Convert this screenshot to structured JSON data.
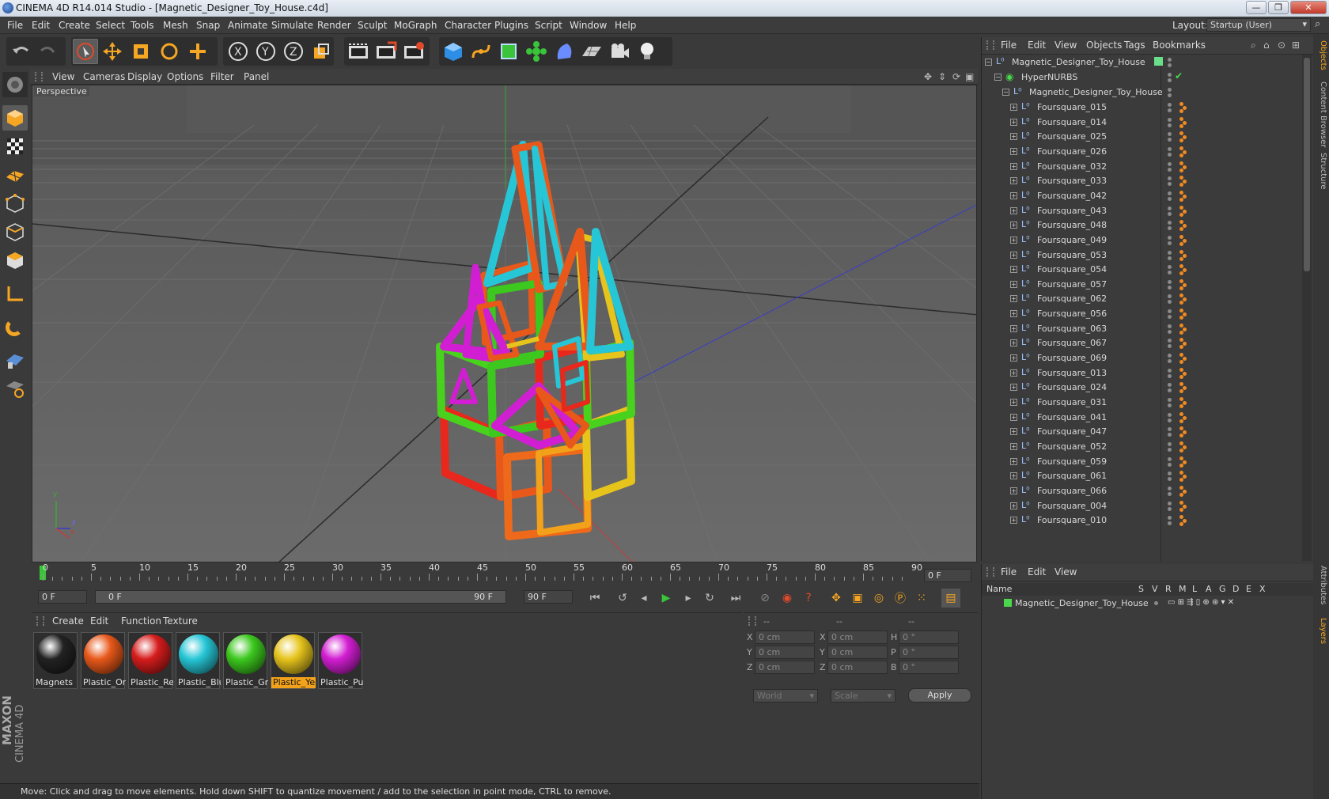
{
  "window": {
    "title": "CINEMA 4D R14.014 Studio - [Magnetic_Designer_Toy_House.c4d]",
    "min": "—",
    "max": "❐",
    "close": "✕"
  },
  "menu": [
    "File",
    "Edit",
    "Create",
    "Select",
    "Tools",
    "Mesh",
    "Snap",
    "Animate",
    "Simulate",
    "Render",
    "Sculpt",
    "MoGraph",
    "Character",
    "Plugins",
    "Script",
    "Window",
    "Help"
  ],
  "layout": {
    "label": "Layout:",
    "value": "Startup (User)"
  },
  "toolbar": {
    "icons": [
      "undo-icon",
      "redo-icon",
      "live-selection-icon",
      "move-icon",
      "scale-icon",
      "rotate-icon",
      "add-icon",
      "x-axis-icon",
      "y-axis-icon",
      "z-axis-icon",
      "world-coord-icon",
      "render-view-icon",
      "render-picture-queue-icon",
      "render-settings-icon",
      "cube-icon",
      "spline-icon",
      "nurbs-icon",
      "array-icon",
      "deformer-icon",
      "floor-icon",
      "camera-icon",
      "light-icon"
    ]
  },
  "viewport": {
    "menu": [
      "View",
      "Cameras",
      "Display",
      "Options",
      "Filter",
      "Panel"
    ],
    "label": "Perspective",
    "axis": {
      "x": "x",
      "y": "y",
      "z": "z"
    }
  },
  "timeline": {
    "ticks": [
      "0",
      "5",
      "10",
      "15",
      "20",
      "25",
      "30",
      "35",
      "40",
      "45",
      "50",
      "55",
      "60",
      "65",
      "70",
      "75",
      "80",
      "85",
      "90"
    ],
    "current_frame": "0 F",
    "start_frame": "0 F",
    "range_start": "0 F",
    "range_end": "90 F",
    "end_frame": "90 F"
  },
  "materials": {
    "menu": [
      "Create",
      "Edit",
      "Function",
      "Texture"
    ],
    "items": [
      {
        "name": "Magnets",
        "color": "#222222",
        "selected": false
      },
      {
        "name": "Plastic_Ora",
        "color": "#e8581a",
        "selected": false
      },
      {
        "name": "Plastic_Red",
        "color": "#d61c1c",
        "selected": false
      },
      {
        "name": "Plastic_Blu",
        "color": "#26c6d6",
        "selected": false
      },
      {
        "name": "Plastic_Gre",
        "color": "#3cc81e",
        "selected": false
      },
      {
        "name": "Plastic_Yell",
        "color": "#e6c41c",
        "selected": true
      },
      {
        "name": "Plastic_Pur",
        "color": "#d21ed2",
        "selected": false
      }
    ]
  },
  "coords": {
    "headers": [
      "--",
      "--",
      "--"
    ],
    "rows": [
      {
        "l1": "X",
        "v1": "0 cm",
        "l2": "X",
        "v2": "0 cm",
        "l3": "H",
        "v3": "0 °"
      },
      {
        "l1": "Y",
        "v1": "0 cm",
        "l2": "Y",
        "v2": "0 cm",
        "l3": "P",
        "v3": "0 °"
      },
      {
        "l1": "Z",
        "v1": "0 cm",
        "l2": "Z",
        "v2": "0 cm",
        "l3": "B",
        "v3": "0 °"
      }
    ],
    "mode": "World",
    "scale": "Scale",
    "apply": "Apply"
  },
  "objects": {
    "menu": [
      "File",
      "Edit",
      "View",
      "Objects",
      "Tags",
      "Bookmarks"
    ],
    "root": "Magnetic_Designer_Toy_House",
    "hypernurbs": "HyperNURBS",
    "child_group": "Magnetic_Designer_Toy_House",
    "items": [
      "Foursquare_015",
      "Foursquare_014",
      "Foursquare_025",
      "Foursquare_026",
      "Foursquare_032",
      "Foursquare_033",
      "Foursquare_042",
      "Foursquare_043",
      "Foursquare_048",
      "Foursquare_049",
      "Foursquare_053",
      "Foursquare_054",
      "Foursquare_057",
      "Foursquare_062",
      "Foursquare_056",
      "Foursquare_063",
      "Foursquare_067",
      "Foursquare_069",
      "Foursquare_013",
      "Foursquare_024",
      "Foursquare_031",
      "Foursquare_041",
      "Foursquare_047",
      "Foursquare_052",
      "Foursquare_059",
      "Foursquare_061",
      "Foursquare_066",
      "Foursquare_004",
      "Foursquare_010"
    ]
  },
  "layers": {
    "menu": [
      "File",
      "Edit",
      "View"
    ],
    "columns": [
      "Name",
      "S",
      "V",
      "R",
      "M",
      "L",
      "A",
      "G",
      "D",
      "E",
      "X"
    ],
    "row": "Magnetic_Designer_Toy_House"
  },
  "right_tabs": [
    "Objects",
    "Content Browser",
    "Structure",
    "Attributes",
    "Layers"
  ],
  "brand": {
    "maxon": "MAXON",
    "c4d": "CINEMA 4D"
  },
  "status": "Move: Click and drag to move elements. Hold down SHIFT to quantize movement / add to the selection in point mode, CTRL to remove."
}
